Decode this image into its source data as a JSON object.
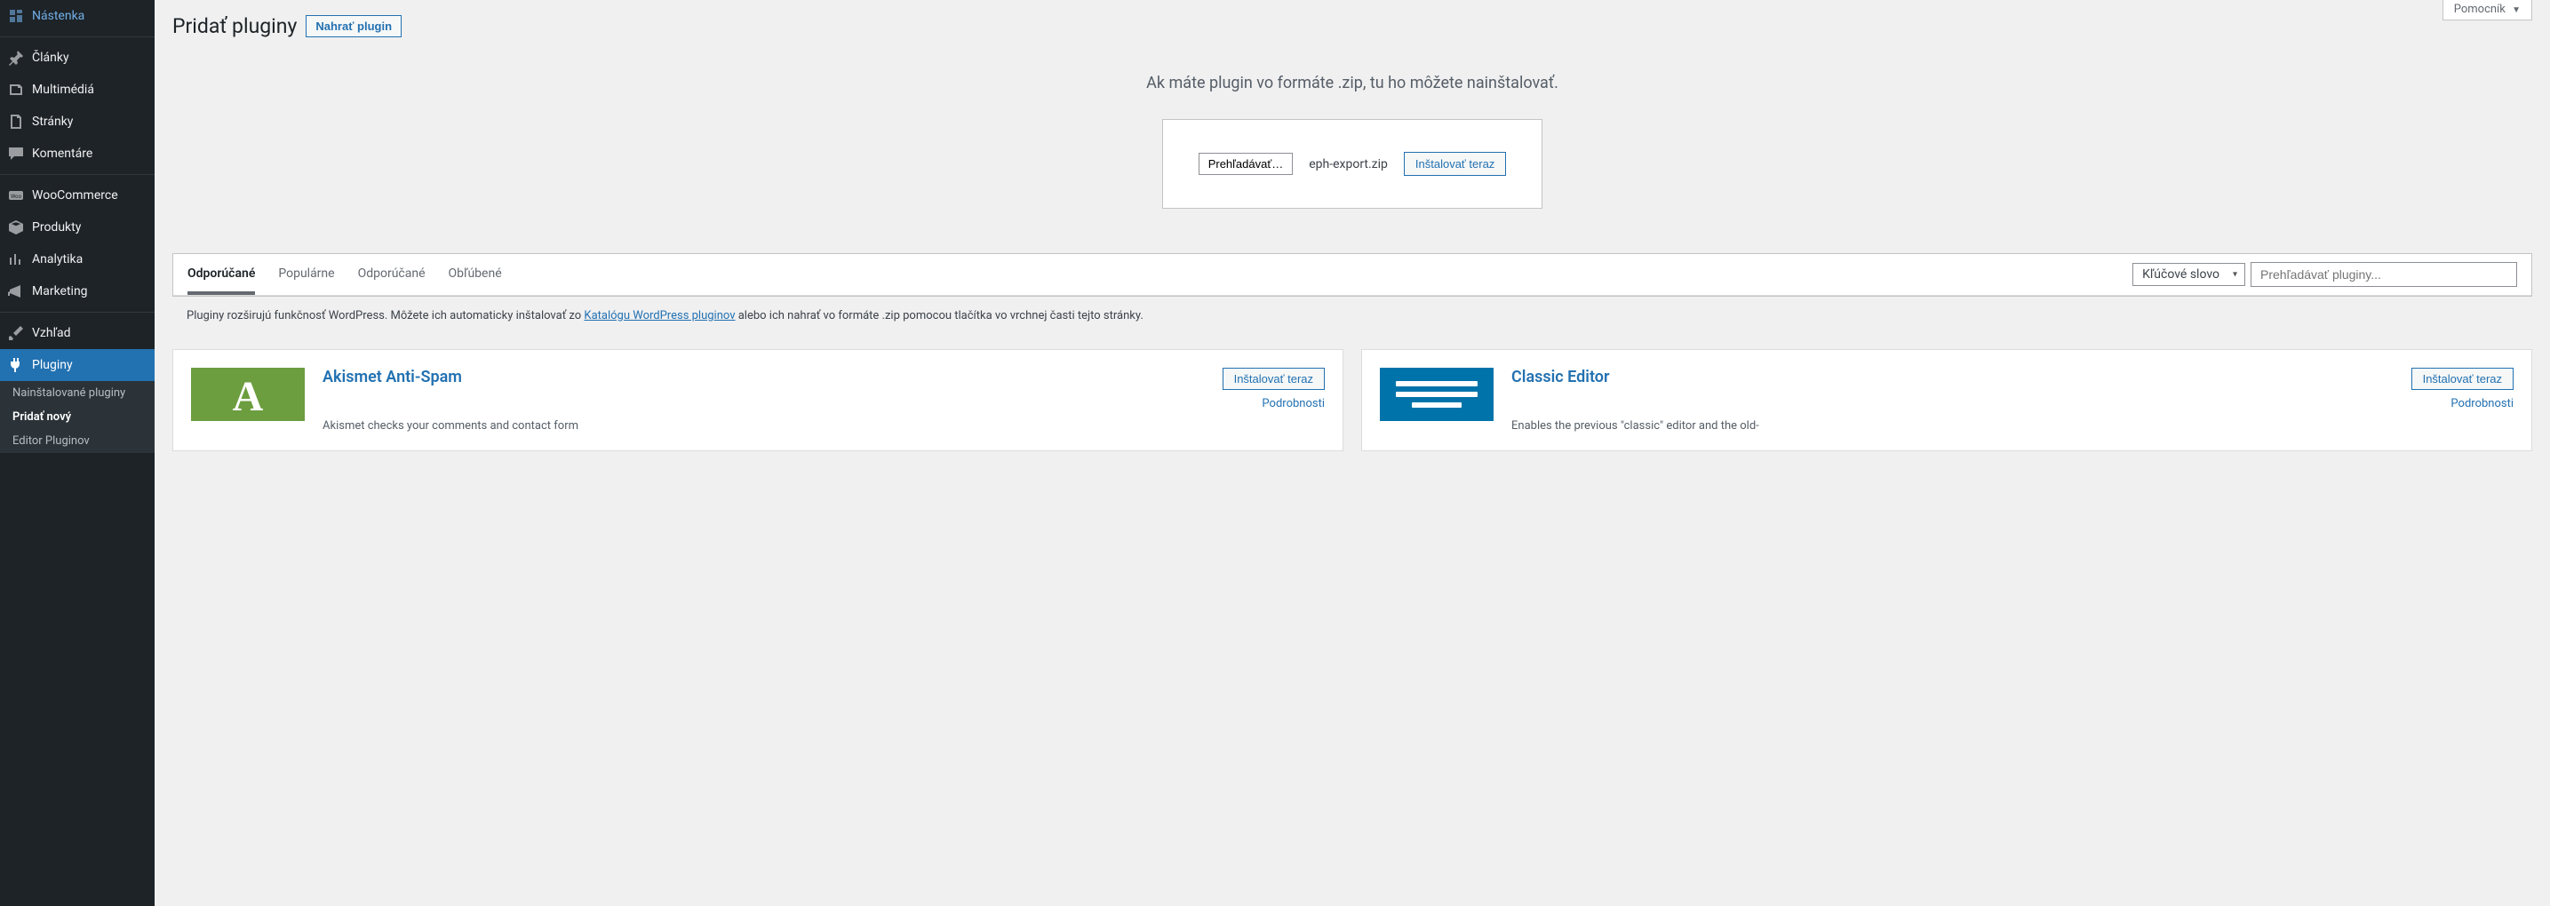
{
  "help_tab": {
    "label": "Pomocník"
  },
  "sidebar": {
    "items": [
      {
        "label": "Nástenka",
        "name": "menu-dashboard",
        "icon": "dashboard-icon"
      },
      {
        "label": "Články",
        "name": "menu-posts",
        "icon": "pin-icon"
      },
      {
        "label": "Multimédiá",
        "name": "menu-media",
        "icon": "media-icon"
      },
      {
        "label": "Stránky",
        "name": "menu-pages",
        "icon": "page-icon"
      },
      {
        "label": "Komentáre",
        "name": "menu-comments",
        "icon": "comment-icon"
      },
      {
        "label": "WooCommerce",
        "name": "menu-woocommerce",
        "icon": "woo-icon"
      },
      {
        "label": "Produkty",
        "name": "menu-products",
        "icon": "product-icon"
      },
      {
        "label": "Analytika",
        "name": "menu-analytics",
        "icon": "analytics-icon"
      },
      {
        "label": "Marketing",
        "name": "menu-marketing",
        "icon": "marketing-icon"
      },
      {
        "label": "Vzhľad",
        "name": "menu-appearance",
        "icon": "brush-icon"
      },
      {
        "label": "Pluginy",
        "name": "menu-plugins",
        "icon": "plug-icon"
      }
    ],
    "submenu": [
      {
        "label": "Nainštalované pluginy",
        "name": "submenu-installed",
        "current": false
      },
      {
        "label": "Pridať nový",
        "name": "submenu-add-new",
        "current": true
      },
      {
        "label": "Editor Pluginov",
        "name": "submenu-editor",
        "current": false
      }
    ],
    "separators_after": [
      0,
      4,
      8
    ]
  },
  "header": {
    "title": "Pridať pluginy",
    "upload_button": "Nahrať plugin"
  },
  "upload": {
    "hint": "Ak máte plugin vo formáte .zip, tu ho môžete nainštalovať.",
    "browse_label": "Prehľadávať…",
    "filename": "eph-export.zip",
    "install_label": "Inštalovať teraz"
  },
  "filters": {
    "tabs": [
      {
        "label": "Odporúčané",
        "active": true
      },
      {
        "label": "Populárne",
        "active": false
      },
      {
        "label": "Odporúčané",
        "active": false
      },
      {
        "label": "Obľúbené",
        "active": false
      }
    ],
    "search_type": "Kľúčové slovo",
    "search_placeholder": "Prehľadávať pluginy..."
  },
  "catalog_text": {
    "before": "Pluginy rozširujú funkčnosť WordPress. Môžete ich automaticky inštalovať zo ",
    "link": "Katalógu WordPress pluginov",
    "after": " alebo ich nahrať vo formáte .zip pomocou tlačítka vo vrchnej časti tejto stránky."
  },
  "cards": [
    {
      "title": "Akismet Anti-Spam",
      "install_label": "Inštalovať teraz",
      "details_label": "Podrobnosti",
      "desc": "Akismet checks your comments and contact form",
      "icon": "akismet"
    },
    {
      "title": "Classic Editor",
      "install_label": "Inštalovať teraz",
      "details_label": "Podrobnosti",
      "desc": "Enables the previous \"classic\" editor and the old-",
      "icon": "classic"
    }
  ]
}
